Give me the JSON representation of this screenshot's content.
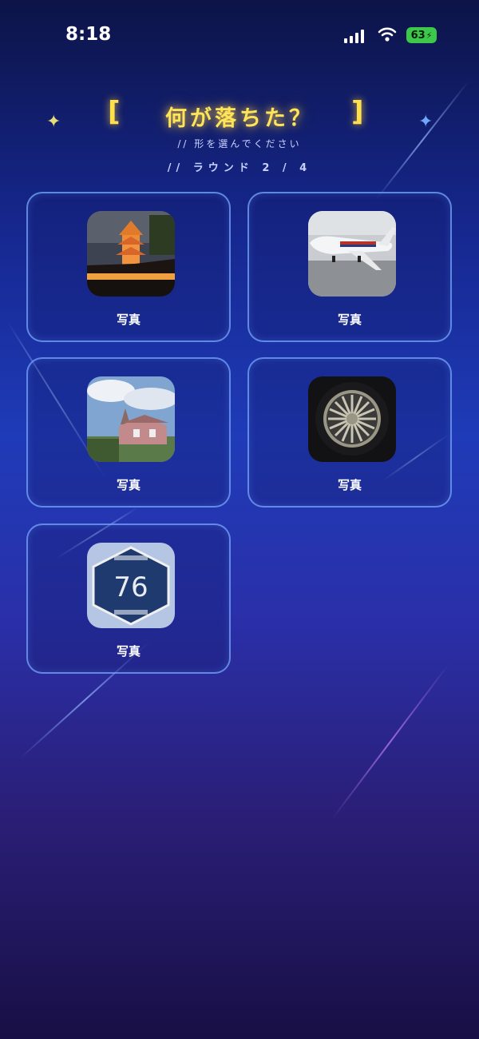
{
  "status": {
    "time": "8:18",
    "battery": "63"
  },
  "header": {
    "open_bracket": "[",
    "title": "何が落ちた？",
    "close_bracket": "]",
    "subtitle": "// 形を選んでください",
    "round": "// ラウンド 2 / 4"
  },
  "options": [
    {
      "label": "写真",
      "icon": "pagoda-night-photo"
    },
    {
      "label": "写真",
      "icon": "airplane-photo"
    },
    {
      "label": "写真",
      "icon": "western-house-photo"
    },
    {
      "label": "写真",
      "icon": "car-wheel-photo"
    },
    {
      "label": "写真",
      "icon": "route-76-sign-photo",
      "sign_number": "76"
    }
  ],
  "colors": {
    "accent": "#ffe04a",
    "card_border": "#78aaff",
    "battery": "#3cc94a"
  }
}
